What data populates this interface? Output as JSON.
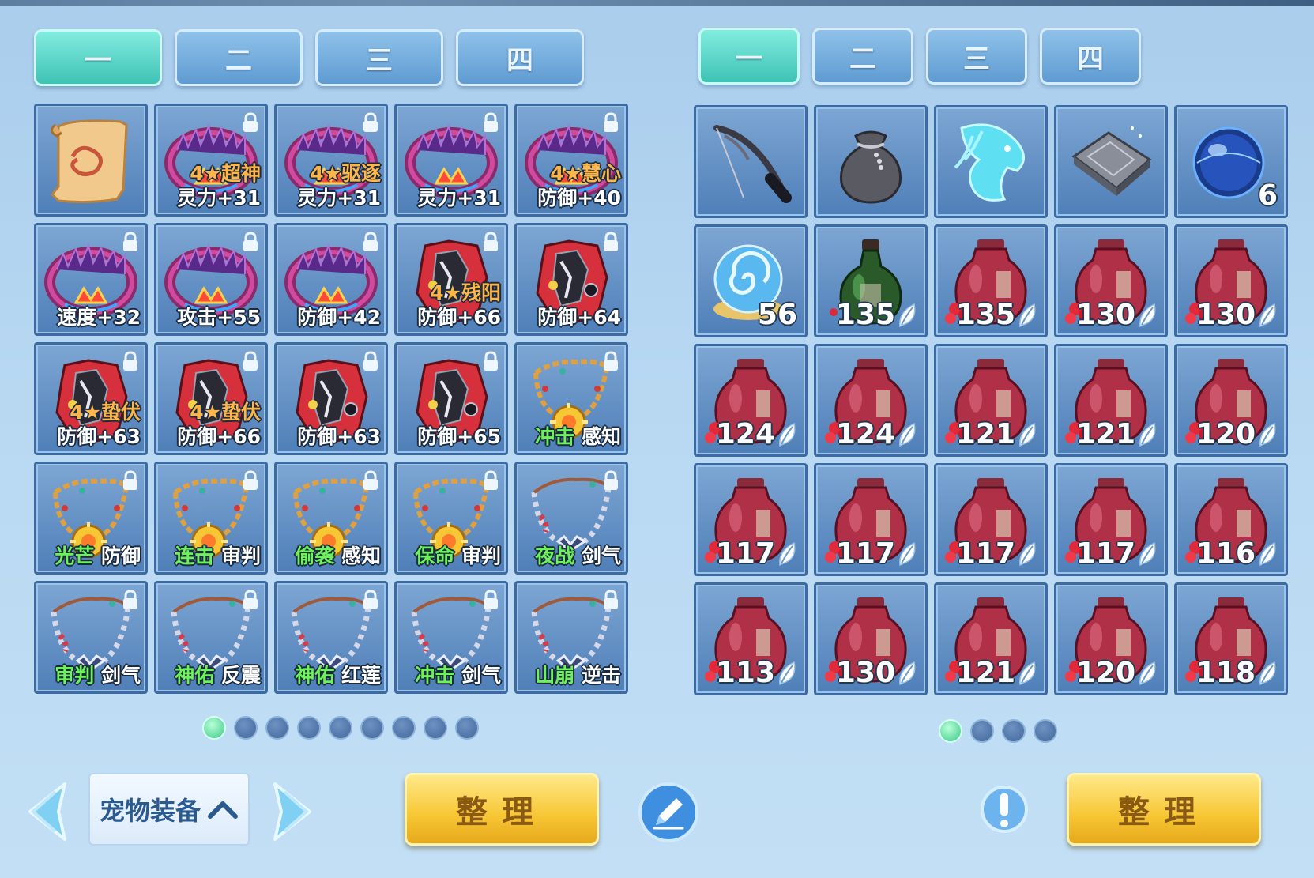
{
  "left_panel": {
    "tabs": [
      "一",
      "二",
      "三",
      "四"
    ],
    "active_tab": 0,
    "pages": 9,
    "active_page": 0,
    "items": [
      {
        "art": "scroll",
        "locked": false,
        "line1": "",
        "line2": ""
      },
      {
        "art": "collar",
        "locked": true,
        "line1": "4★超神",
        "line2": "灵力+31"
      },
      {
        "art": "collar",
        "locked": true,
        "line1": "4★驱逐",
        "line2": "灵力+31"
      },
      {
        "art": "collar",
        "locked": true,
        "line1": "",
        "line2": "灵力+31"
      },
      {
        "art": "collar",
        "locked": true,
        "line1": "4★慧心",
        "line2": "防御+40"
      },
      {
        "art": "collar",
        "locked": true,
        "line1": "",
        "line2": "速度+32"
      },
      {
        "art": "collar",
        "locked": true,
        "line1": "",
        "line2": "攻击+55"
      },
      {
        "art": "collar",
        "locked": true,
        "line1": "",
        "line2": "防御+42"
      },
      {
        "art": "armor",
        "locked": true,
        "line1": "4★残阳",
        "line2": "防御+66"
      },
      {
        "art": "armor",
        "locked": true,
        "line1": "",
        "line2": "防御+64"
      },
      {
        "art": "armor",
        "locked": true,
        "line1": "4★蛰伏",
        "line2": "防御+63"
      },
      {
        "art": "armor",
        "locked": true,
        "line1": "4★蛰伏",
        "line2": "防御+66"
      },
      {
        "art": "armor",
        "locked": true,
        "line1": "",
        "line2": "防御+63"
      },
      {
        "art": "armor",
        "locked": true,
        "line1": "",
        "line2": "防御+65"
      },
      {
        "art": "necklace-gold",
        "locked": true,
        "skill1": "冲击",
        "skill2": "感知"
      },
      {
        "art": "necklace-gold",
        "locked": true,
        "skill1": "光芒",
        "skill2": "防御"
      },
      {
        "art": "necklace-gold",
        "locked": true,
        "skill1": "连击",
        "skill2": "审判"
      },
      {
        "art": "necklace-gold",
        "locked": true,
        "skill1": "偷袭",
        "skill2": "感知"
      },
      {
        "art": "necklace-gold",
        "locked": true,
        "skill1": "保命",
        "skill2": "审判"
      },
      {
        "art": "necklace-silver",
        "locked": true,
        "skill1": "夜战",
        "skill2": "剑气"
      },
      {
        "art": "necklace-silver",
        "locked": true,
        "skill1": "审判",
        "skill2": "剑气"
      },
      {
        "art": "necklace-silver",
        "locked": true,
        "skill1": "神佑",
        "skill2": "反震"
      },
      {
        "art": "necklace-silver",
        "locked": true,
        "skill1": "神佑",
        "skill2": "红莲"
      },
      {
        "art": "necklace-silver",
        "locked": true,
        "skill1": "冲击",
        "skill2": "剑气"
      },
      {
        "art": "necklace-silver",
        "locked": true,
        "skill1": "山崩",
        "skill2": "逆击"
      }
    ]
  },
  "right_panel": {
    "tabs": [
      "一",
      "二",
      "三",
      "四"
    ],
    "active_tab": 0,
    "pages": 4,
    "active_page": 0,
    "items": [
      {
        "art": "fishing-rod",
        "count": "",
        "leaf": false
      },
      {
        "art": "pouch",
        "count": "",
        "leaf": false
      },
      {
        "art": "spirit-horse",
        "count": "",
        "leaf": false
      },
      {
        "art": "metal-bar",
        "count": "",
        "leaf": false
      },
      {
        "art": "blue-orb",
        "count": "6",
        "leaf": false
      },
      {
        "art": "swirl-orb",
        "count": "56",
        "leaf": false
      },
      {
        "art": "green-bottle",
        "count": "135",
        "leaf": true
      },
      {
        "art": "wine-jar",
        "count": "135",
        "leaf": true
      },
      {
        "art": "wine-jar",
        "count": "130",
        "leaf": true
      },
      {
        "art": "wine-jar",
        "count": "130",
        "leaf": true
      },
      {
        "art": "wine-jar",
        "count": "124",
        "leaf": true
      },
      {
        "art": "wine-jar",
        "count": "124",
        "leaf": true
      },
      {
        "art": "wine-jar",
        "count": "121",
        "leaf": true
      },
      {
        "art": "wine-jar",
        "count": "121",
        "leaf": true
      },
      {
        "art": "wine-jar",
        "count": "120",
        "leaf": true
      },
      {
        "art": "wine-jar",
        "count": "117",
        "leaf": true
      },
      {
        "art": "wine-jar",
        "count": "117",
        "leaf": true
      },
      {
        "art": "wine-jar",
        "count": "117",
        "leaf": true
      },
      {
        "art": "wine-jar",
        "count": "117",
        "leaf": true
      },
      {
        "art": "wine-jar",
        "count": "116",
        "leaf": true
      },
      {
        "art": "wine-jar",
        "count": "113",
        "leaf": true
      },
      {
        "art": "wine-jar",
        "count": "130",
        "leaf": true
      },
      {
        "art": "wine-jar",
        "count": "121",
        "leaf": true
      },
      {
        "art": "wine-jar",
        "count": "120",
        "leaf": true
      },
      {
        "art": "wine-jar",
        "count": "118",
        "leaf": true
      }
    ]
  },
  "bottom_bar": {
    "category_label": "宠物装备",
    "sort_left_label": "整理",
    "sort_right_label": "整理"
  },
  "colors": {
    "tab_active": "#3ec3b5",
    "tab_inactive": "#5f9bd2",
    "slot_bg": "#4f7fb8",
    "sort_button": "#f7c634",
    "skill_text": "#6ef25a",
    "star_text": "#ffb648"
  }
}
